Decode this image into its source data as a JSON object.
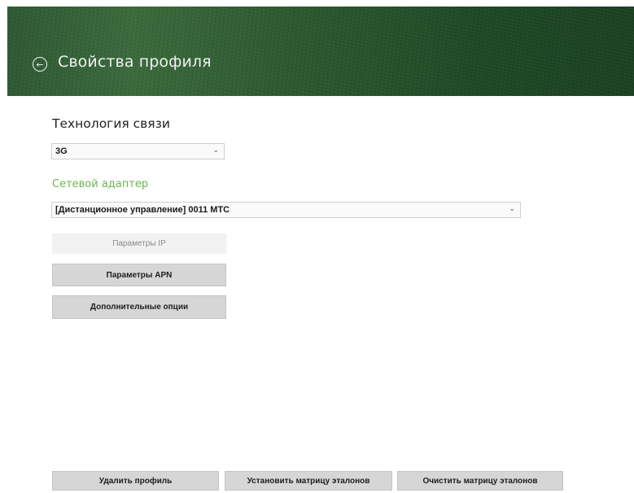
{
  "header": {
    "title": "Свойства профиля",
    "back_icon": "arrow-left-circle-icon",
    "accent": "#2f5a34"
  },
  "connection": {
    "label": "Технология связи",
    "value": "3G"
  },
  "adapter": {
    "label": "Сетевой адаптер",
    "label_color": "#6ab64a",
    "value": "[Дистанционное управление] 0011 МТС"
  },
  "buttons": {
    "ip": "Параметры IP",
    "apn": "Параметры APN",
    "options": "Дополнительные опции"
  },
  "footer": {
    "delete": "Удалить профиль",
    "set_matrix": "Установить матрицу эталонов",
    "clear_matrix": "Очистить матрицу эталонов"
  }
}
